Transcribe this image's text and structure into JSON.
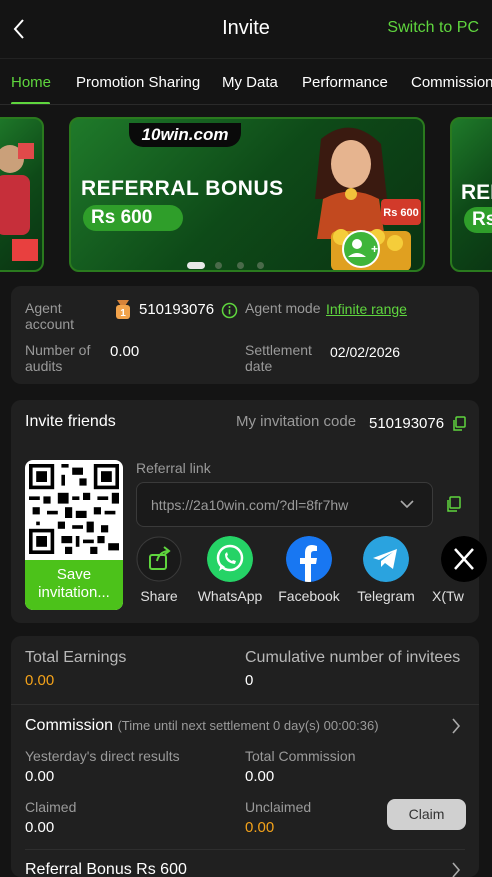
{
  "header": {
    "title": "Invite",
    "switch_label": "Switch to PC"
  },
  "tabs": [
    {
      "label": "Home",
      "active": true
    },
    {
      "label": "Promotion Sharing"
    },
    {
      "label": "My Data"
    },
    {
      "label": "Performance"
    },
    {
      "label": "Commission"
    }
  ],
  "banner": {
    "logo": "10win.com",
    "headline": "REFERRAL BONUS",
    "amount": "Rs 600",
    "peek_headline": "REF",
    "peek_amount": "Rs",
    "slide_count": 4,
    "active_slide": 1
  },
  "agent": {
    "account_label": "Agent account",
    "account_value": "510193076",
    "mode_label": "Agent mode",
    "mode_value": "Infinite range",
    "audits_label": "Number of audits",
    "audits_value": "0.00",
    "settlement_label": "Settlement date",
    "settlement_value": "02/02/2026"
  },
  "invite": {
    "title": "Invite friends",
    "code_label": "My invitation code",
    "code_value": "510193076",
    "save_label": "Save invitation...",
    "referral_label": "Referral link",
    "referral_value": "https://2a10win.com/?dl=8fr7hw",
    "share_options": [
      {
        "name": "Share",
        "icon": "share-icon",
        "color": "#1a1a1a"
      },
      {
        "name": "WhatsApp",
        "icon": "whatsapp-icon",
        "color": "#25d366"
      },
      {
        "name": "Facebook",
        "icon": "facebook-icon",
        "color": "#1877f2"
      },
      {
        "name": "Telegram",
        "icon": "telegram-icon",
        "color": "#2aa3df"
      },
      {
        "name": "X(Tw",
        "icon": "x-icon",
        "color": "#000000"
      }
    ]
  },
  "earnings": {
    "total_label": "Total Earnings",
    "total_value": "0.00",
    "invitees_label": "Cumulative number of invitees",
    "invitees_value": "0"
  },
  "commission": {
    "title": "Commission",
    "countdown": "(Time until next settlement  0 day(s) 00:00:36)",
    "yesterday_label": "Yesterday's direct results",
    "yesterday_value": "0.00",
    "total_label": "Total Commission",
    "total_value": "0.00",
    "claimed_label": "Claimed",
    "claimed_value": "0.00",
    "unclaimed_label": "Unclaimed",
    "unclaimed_value": "0.00",
    "claim_button": "Claim"
  },
  "referral_bonus": {
    "title": "Referral Bonus Rs 600"
  },
  "colors": {
    "accent": "#5fd63e",
    "highlight": "#f3a21a",
    "card": "#202020",
    "background": "#141414"
  }
}
